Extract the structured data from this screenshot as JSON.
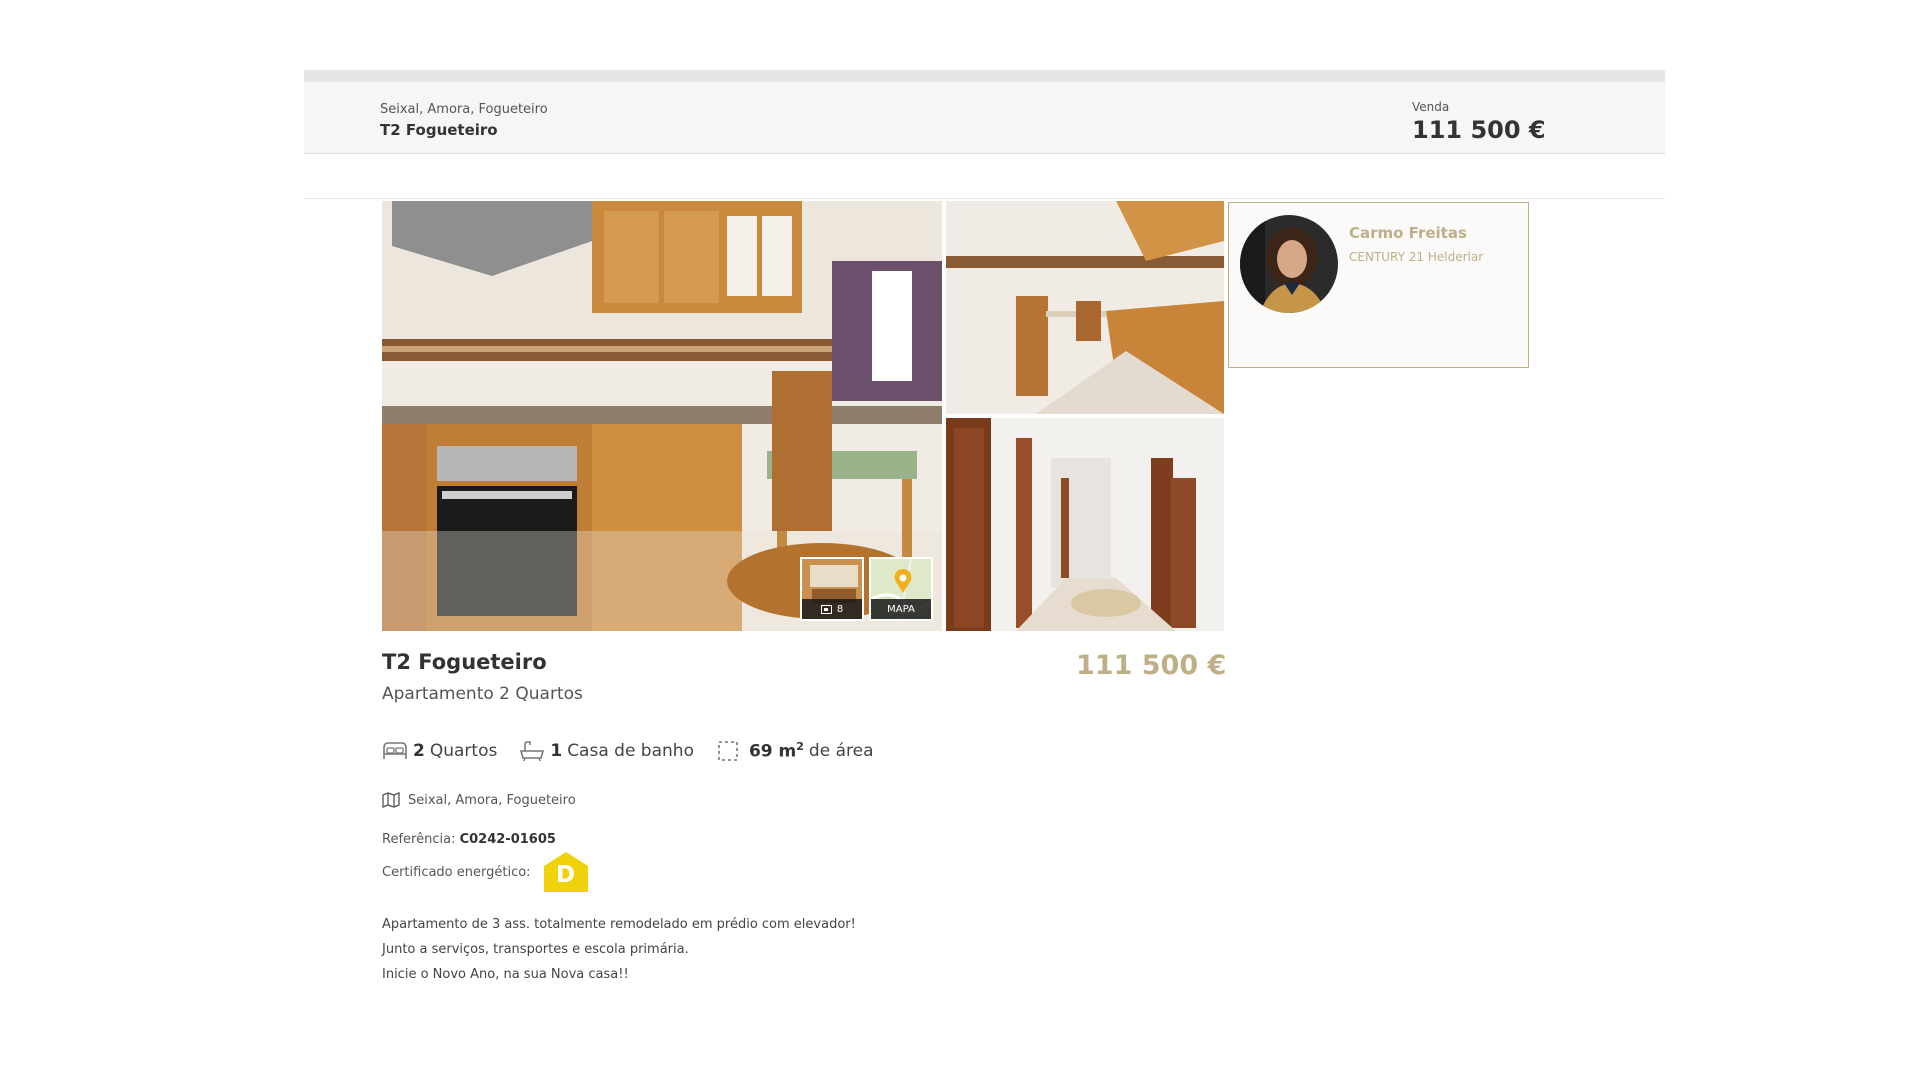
{
  "header": {
    "location": "Seixal, Amora, Fogueteiro",
    "title": "T2 Fogueteiro",
    "sale_label": "Venda",
    "price": "111 500 €"
  },
  "gallery": {
    "photo_count": "8",
    "map_label": "MAPA"
  },
  "agent": {
    "name": "Carmo Freitas",
    "agency": "CENTURY 21 Helderlar"
  },
  "listing": {
    "title": "T2 Fogueteiro",
    "subtitle": "Apartamento 2 Quartos",
    "price": "111 500 €",
    "features": {
      "bedrooms_count": "2",
      "bedrooms_label": "Quartos",
      "bathrooms_count": "1",
      "bathrooms_label": "Casa de banho",
      "area_value": "69 m",
      "area_sup": "2",
      "area_label": "de área"
    },
    "location": "Seixal, Amora, Fogueteiro",
    "reference_label": "Referência:",
    "reference_value": "C0242-01605",
    "energy_label": "Certificado energético:",
    "energy_class": "D",
    "description": [
      "Apartamento de 3 ass. totalmente remodelado em prédio com elevador!",
      "Junto a serviços, transportes e escola primária.",
      "Inicie o Novo Ano, na sua Nova casa!!"
    ]
  },
  "colors": {
    "accent_gold": "#beaf87",
    "energy_yellow": "#f0d20a",
    "header_bg": "#f6f6f6"
  },
  "icons": [
    "bed-icon",
    "bathtub-icon",
    "area-icon",
    "map-icon",
    "camera-icon",
    "map-pin-icon"
  ]
}
